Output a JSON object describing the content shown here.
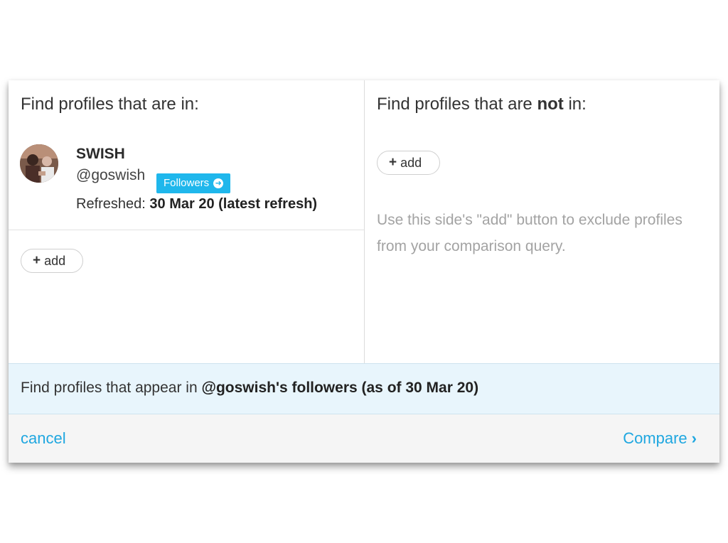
{
  "left_panel": {
    "title": "Find profiles that are in:",
    "profile": {
      "name": "SWISH",
      "handle": "@goswish",
      "badge_label": "Followers",
      "badge_icon": "circle-arrow-icon",
      "refreshed_label": "Refreshed:",
      "refreshed_value": "30 Mar 20 (latest refresh)"
    },
    "add_label": "add"
  },
  "right_panel": {
    "title_prefix": "Find profiles that are",
    "title_bold": "not",
    "title_suffix": "in:",
    "add_label": "add",
    "hint": "Use this side's \"add\" button to exclude profiles from your comparison query."
  },
  "summary": {
    "prefix": "Find profiles that appear in",
    "bold": "@goswish's followers (as of 30 Mar 20)"
  },
  "footer": {
    "cancel_label": "cancel",
    "compare_label": "Compare"
  },
  "colors": {
    "accent": "#1fa7e0",
    "badge": "#1fb7ec",
    "summary_bg": "#e8f5fc",
    "footer_bg": "#f5f5f5",
    "hint_text": "#a3a3a3"
  }
}
